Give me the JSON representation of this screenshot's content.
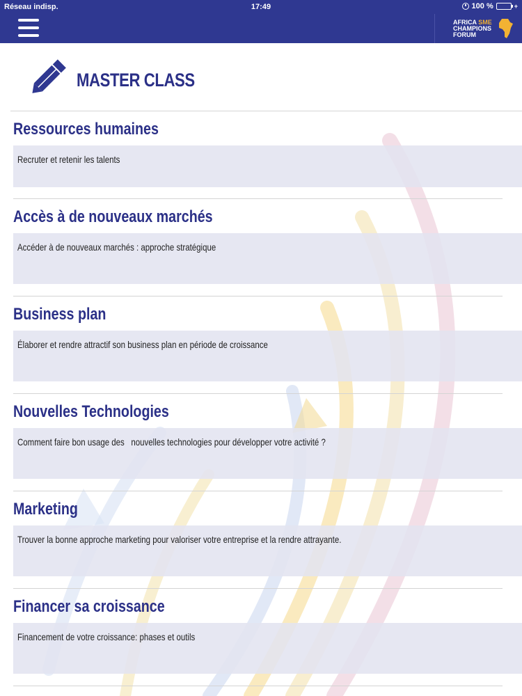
{
  "status_bar": {
    "carrier": "Réseau indisp.",
    "time": "17:49",
    "battery": "100 %"
  },
  "header": {
    "menu_icon": "hamburger-menu-icon",
    "logo": {
      "line1_a": "AFRICA",
      "line1_b": "SME",
      "line2": "CHAMPIONS",
      "line3": "FORUM"
    }
  },
  "page": {
    "icon": "pencil-icon",
    "title": "MASTER CLASS"
  },
  "sections": [
    {
      "title": "Ressources humaines",
      "description": "Recruter et retenir les talents"
    },
    {
      "title": "Accès à de nouveaux marchés",
      "description": "Accéder à de nouveaux marchés : approche stratégique"
    },
    {
      "title": "Business plan",
      "description": "Élaborer et rendre attractif son business plan en période de croissance"
    },
    {
      "title": "Nouvelles Technologies",
      "description": "Comment faire bon usage des   nouvelles technologies pour développer votre activité ?"
    },
    {
      "title": "Marketing",
      "description": "Trouver la bonne approche marketing pour valoriser votre entreprise et la rendre attrayante."
    },
    {
      "title": "Financer sa croissance",
      "description": "Financement de votre croissance: phases et outils"
    }
  ],
  "colors": {
    "header_bg": "#2f3891",
    "title_text": "#2b3087",
    "accent": "#f2b233"
  }
}
